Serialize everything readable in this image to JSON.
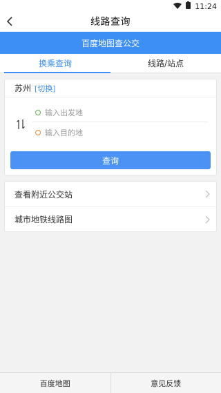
{
  "status_bar": {
    "time": "11:24"
  },
  "header": {
    "title": "线路查询"
  },
  "banner": {
    "text": "百度地图查公交"
  },
  "tabs": [
    {
      "label": "换乘查询",
      "active": true
    },
    {
      "label": "线路/站点",
      "active": false
    }
  ],
  "route_card": {
    "city": "苏州",
    "switch_label": "[切换]",
    "from_placeholder": "输入出发地",
    "to_placeholder": "输入目的地",
    "search_label": "查询"
  },
  "menu": [
    {
      "label": "查看附近公交站"
    },
    {
      "label": "城市地铁线路图"
    }
  ],
  "bottom_nav": [
    {
      "label": "百度地图"
    },
    {
      "label": "意见反馈"
    }
  ],
  "colors": {
    "accent": "#3d8ff5",
    "from_dot": "#5ab44a",
    "to_dot": "#f08a2e"
  }
}
